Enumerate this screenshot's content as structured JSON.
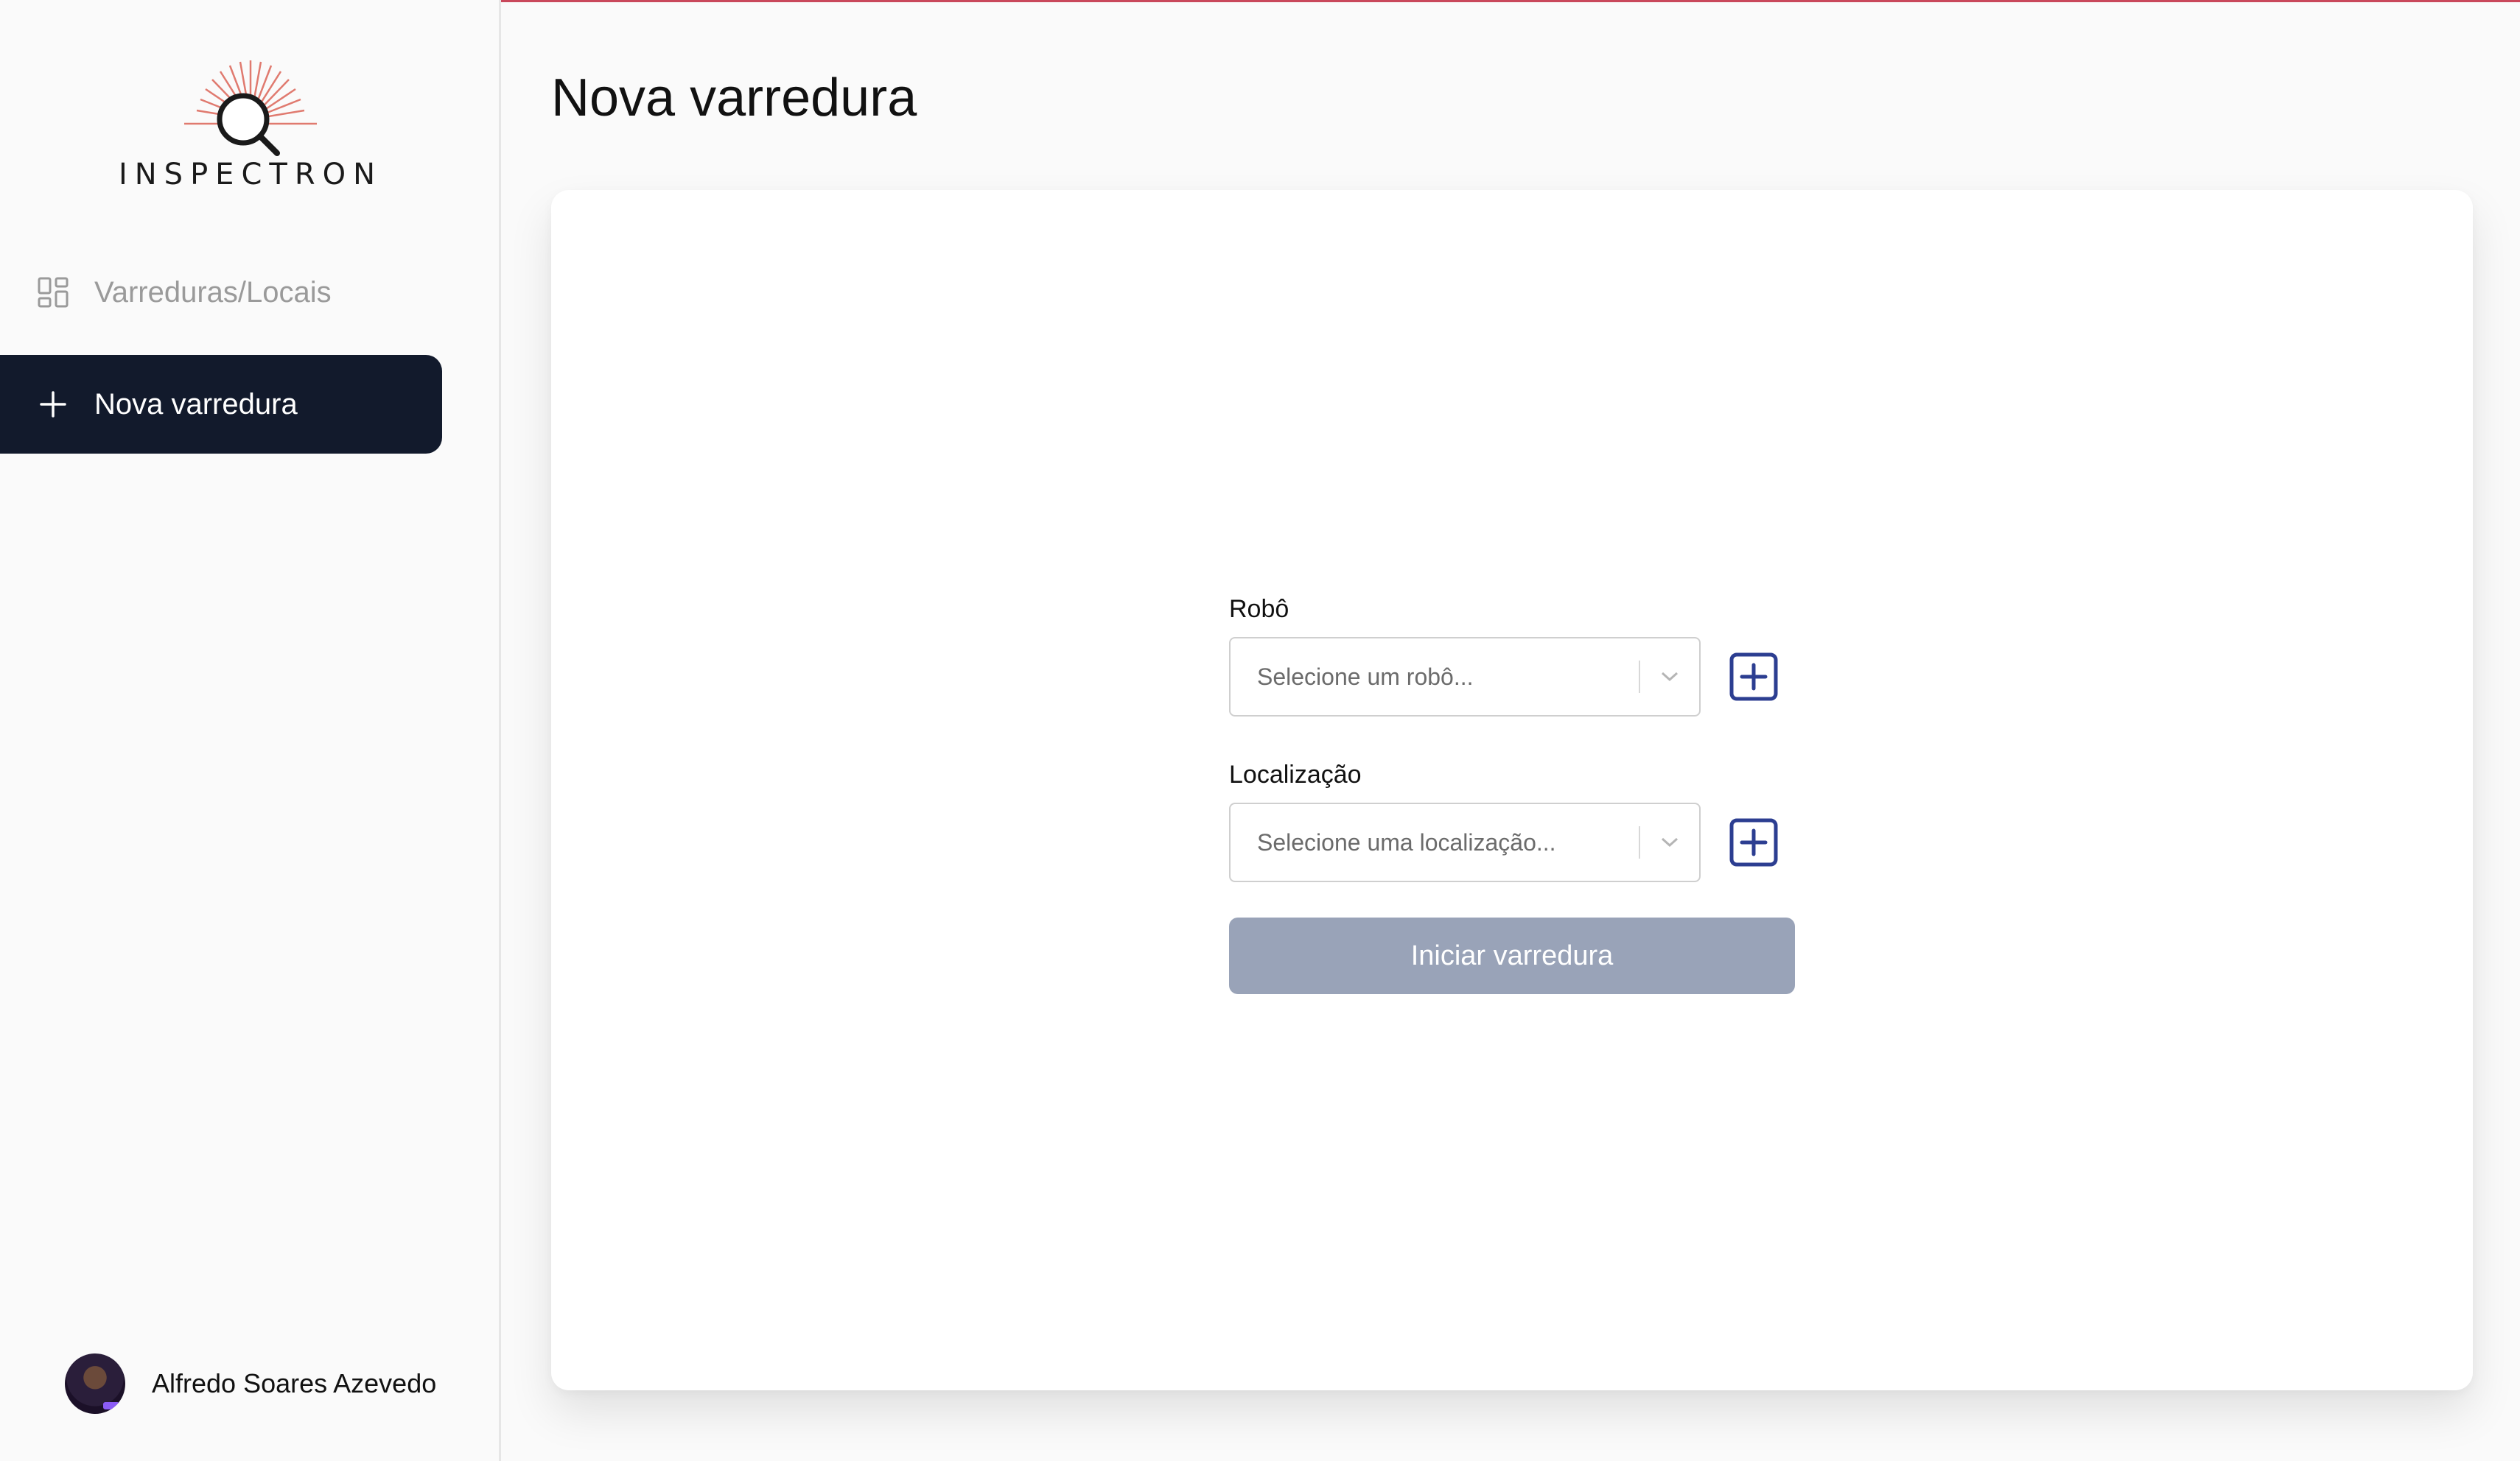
{
  "brand": {
    "name": "INSPECTRON",
    "accent": "#d9534f"
  },
  "sidebar": {
    "items": [
      {
        "label": "Varreduras/Locais",
        "icon": "dashboard-grid-icon",
        "active": false
      },
      {
        "label": "Nova varredura",
        "icon": "plus-icon",
        "active": true
      }
    ],
    "user": {
      "name": "Alfredo Soares Azevedo"
    }
  },
  "main": {
    "title": "Nova varredura",
    "form": {
      "robot": {
        "label": "Robô",
        "placeholder": "Selecione um robô..."
      },
      "location": {
        "label": "Localização",
        "placeholder": "Selecione uma localização..."
      },
      "submit_label": "Iniciar varredura"
    }
  },
  "colors": {
    "active_nav_bg": "#121a2c",
    "add_icon": "#2c3e91",
    "disabled_button": "#99a3b8"
  }
}
